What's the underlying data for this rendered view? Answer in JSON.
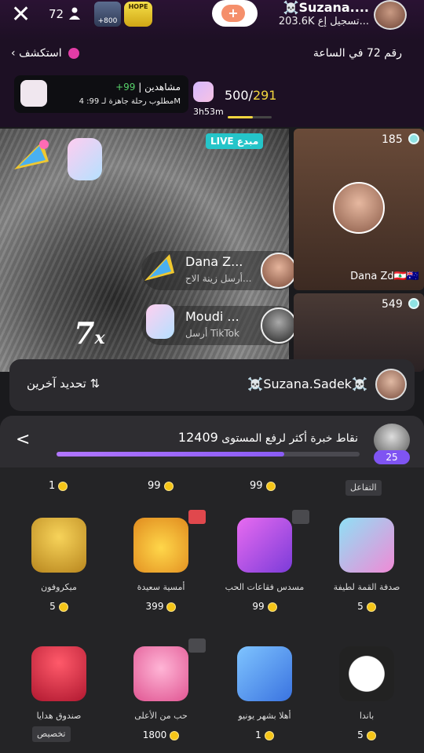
{
  "topbar": {
    "viewers": "72",
    "badge_a": "+800",
    "badge_b": "HOPE",
    "host_name": "☠️Suzana....",
    "host_sub": "203.6K تسجيل إع..."
  },
  "row2": {
    "explore": "استكشف",
    "rank": "رقم 72 في الساعة"
  },
  "goal": {
    "line1_green": "+99",
    "line1_rest": " | مشاهدين",
    "line2": "مطلوب رحلة جاهزة لـ 99: 4M",
    "timer": "3h53m",
    "progress_current": "291",
    "progress_total": "500/",
    "progress_fraction": 0.58
  },
  "stream": {
    "live_label": "LIVE",
    "live_sub": "مبدع",
    "combo": "7",
    "combo_x": "x",
    "notifs": [
      {
        "name": "Dana Z...",
        "sub": "أرسل زينة الاح..."
      },
      {
        "name": "Moudi ...",
        "sub": "أرسل TikTok"
      }
    ],
    "tiles": [
      {
        "count": "185",
        "name": "Dana Zd🇱🇧🇦🇺"
      },
      {
        "count": "549"
      }
    ]
  },
  "share": {
    "name": "☠️Suzana.Sadek☠️",
    "refresh": "تحديد آخرين ⇅"
  },
  "panel": {
    "back": "<",
    "level_points": "12409",
    "level_text": "نقاط خبرة أكثر لرفع المستوى",
    "level_progress": 0.75,
    "level_badge": "25",
    "row0_prices": [
      "1",
      "99",
      "99"
    ],
    "row0_tag": "التفاعل",
    "gifts": [
      {
        "name": "ميكروفون",
        "price": "5"
      },
      {
        "name": "أمسية سعيدة",
        "price": "399"
      },
      {
        "name": "مسدس فقاعات الحب",
        "price": "99"
      },
      {
        "name": "صدفة القمة لطيفة",
        "price": "5"
      },
      {
        "name": "صندوق هدايا",
        "price": ""
      },
      {
        "name": "حب من الأعلى",
        "price": "1800"
      },
      {
        "name": "أهلا بشهر يونيو",
        "price": "1"
      },
      {
        "name": "باندا",
        "price": "5"
      }
    ],
    "custom_tag": "تخصيص",
    "colors": {
      "coin": "#f5c518",
      "accent": "#7f54f2",
      "live": "#25c5c9"
    }
  }
}
